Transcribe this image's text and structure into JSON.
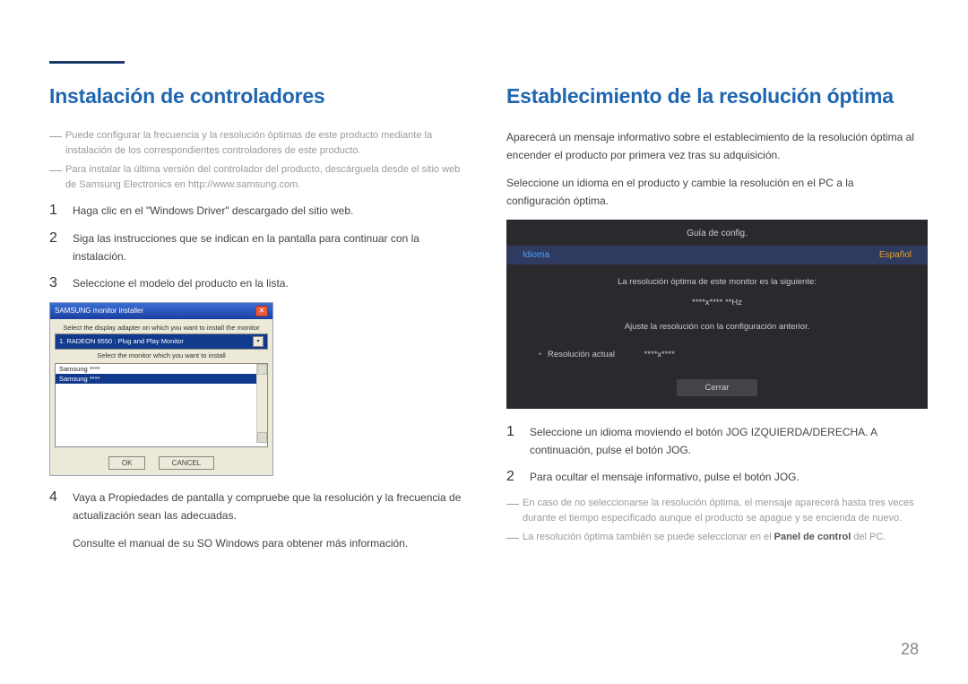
{
  "page_number": "28",
  "left": {
    "heading": "Instalación de controladores",
    "note1": "Puede configurar la frecuencia y la resolución óptimas de este producto mediante la instalación de los correspondientes controladores de este producto.",
    "note2": "Para instalar la última versión del controlador del producto, descárguela desde el sitio web de Samsung Electronics en http://www.samsung.com.",
    "step1": "Haga clic en el \"Windows Driver\" descargado del sitio web.",
    "step2": "Siga las instrucciones que se indican en la pantalla para continuar con la instalación.",
    "step3": "Seleccione el modelo del producto en la lista.",
    "installer": {
      "title": "SAMSUNG monitor installer",
      "label1": "Select the display adapter on which you want to install the monitor",
      "combo": "1. RADEON 9550 : Plug and Play Monitor",
      "label2": "Select the monitor which you want to install",
      "item1": "Samsung ****",
      "item2": "Samsung ****",
      "ok": "OK",
      "cancel": "CANCEL"
    },
    "step4": "Vaya a Propiedades de pantalla y compruebe que la resolución y la frecuencia de actualización sean las adecuadas.",
    "footer": "Consulte el manual de su SO Windows para obtener más información."
  },
  "right": {
    "heading": "Establecimiento de la resolución óptima",
    "para1": "Aparecerá un mensaje informativo sobre el establecimiento de la resolución óptima al encender el producto por primera vez tras su adquisición.",
    "para2": "Seleccione un idioma en el producto y cambie la resolución en el PC a la configuración óptima.",
    "osd": {
      "title": "Guía de config.",
      "lang_label": "Idioma",
      "lang_value": "Español",
      "msg": "La resolución óptima de este monitor es la siguiente:",
      "res": "****x**** **Hz",
      "instr": "Ajuste la resolución con la configuración anterior.",
      "cur_label": "Resolución actual",
      "cur_value": "****x****",
      "close": "Cerrar"
    },
    "step1": "Seleccione un idioma moviendo el botón JOG IZQUIERDA/DERECHA. A continuación, pulse el botón JOG.",
    "step2": "Para ocultar el mensaje informativo, pulse el botón JOG.",
    "note1": "En caso de no seleccionarse la resolución óptima, el mensaje aparecerá hasta tres veces durante el tiempo especificado aunque el producto se apague y se encienda de nuevo.",
    "note2_pre": "La resolución óptima también se puede seleccionar en el ",
    "note2_bold": "Panel de control",
    "note2_post": " del PC."
  }
}
